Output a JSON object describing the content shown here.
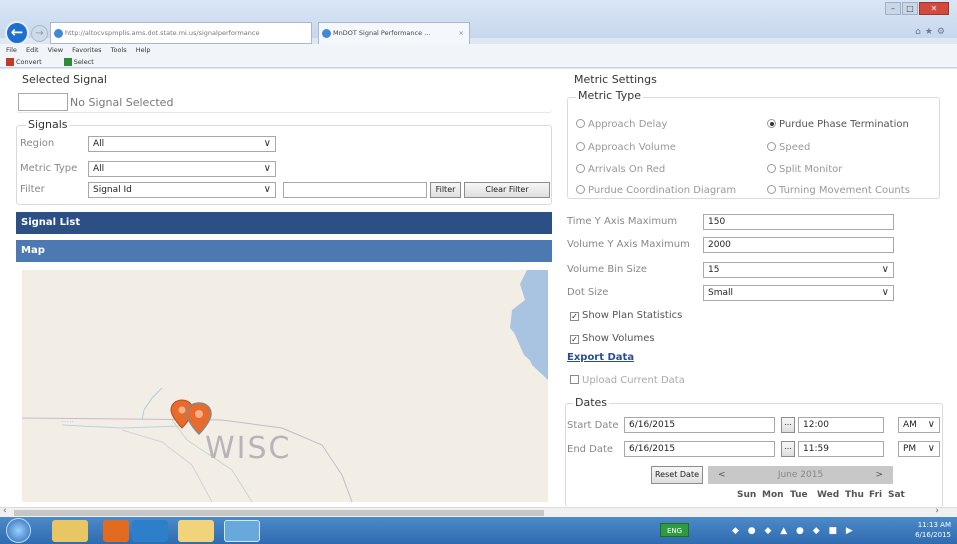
{
  "browser": {
    "address": "http://altocvspmplis.ams.dot.state.mi.us/signalperformance",
    "tab_title": "MnDOT Signal Performance ...",
    "tab_close": "×",
    "menu": [
      "File",
      "Edit",
      "View",
      "Favorites",
      "Tools",
      "Help"
    ],
    "commands": [
      "Convert",
      "Select"
    ]
  },
  "selected_signal": {
    "legend": "Selected Signal",
    "value": "",
    "text": "No Signal Selected"
  },
  "signals": {
    "legend": "Signals",
    "region_label": "Region",
    "region_value": "All",
    "metric_type_label": "Metric Type",
    "metric_type_value": "All",
    "filter_label": "Filter",
    "filter_field_value": "Signal Id",
    "filter_text": "",
    "filter_button": "Filter",
    "clear_filter_button": "Clear Filter"
  },
  "signal_list": {
    "title": "Signal List"
  },
  "map": {
    "title": "Map",
    "place_label": "WISC"
  },
  "metric_settings": {
    "legend": "Metric Settings",
    "type_legend": "Metric Type",
    "options_left": [
      "Approach Delay",
      "Approach Volume",
      "Arrivals On Red",
      "Purdue Coordination Diagram"
    ],
    "options_right": [
      "Purdue Phase Termination",
      "Speed",
      "Split Monitor",
      "Turning Movement Counts"
    ],
    "selected": "Purdue Phase Termination",
    "time_y_label": "Time Y Axis Maximum",
    "time_y_value": "150",
    "volume_y_label": "Volume Y Axis Maximum",
    "volume_y_value": "2000",
    "bin_size_label": "Volume Bin Size",
    "bin_size_value": "15",
    "dot_size_label": "Dot Size",
    "dot_size_value": "Small",
    "show_plan_statistics": "Show Plan Statistics",
    "show_volumes": "Show Volumes",
    "export_data": "Export Data",
    "upload_current_data": "Upload Current Data"
  },
  "dates": {
    "legend": "Dates",
    "start_label": "Start Date",
    "start_value": "6/16/2015",
    "start_time": "12:00",
    "start_ampm": "AM",
    "end_label": "End Date",
    "end_value": "6/16/2015",
    "end_time": "11:59",
    "end_ampm": "PM",
    "ellipsis": "...",
    "reset_button": "Reset Date",
    "calendar_month": "June 2015",
    "prev": "<",
    "next": ">",
    "weekdays": [
      "Sun",
      "Mon",
      "Tue",
      "Wed",
      "Thu",
      "Fri",
      "Sat"
    ]
  },
  "taskbar": {
    "lang": "ENG",
    "time": "11:13 AM",
    "date": "6/16/2015"
  }
}
